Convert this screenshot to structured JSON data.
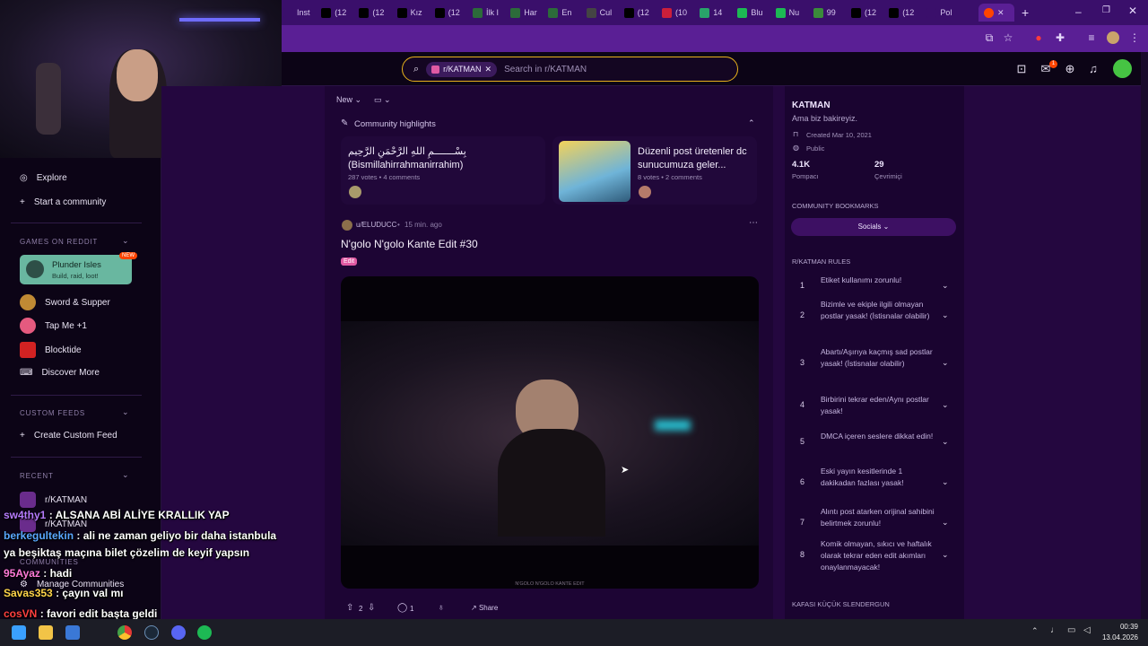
{
  "browser": {
    "tabs": [
      "Inst",
      "(12",
      "(12",
      "Kız",
      "(12",
      "İlk I",
      "Har",
      "En",
      "Cul",
      "(12",
      "(10",
      "14",
      "Blu",
      "Nu",
      "99",
      "(12",
      "(12",
      "Pol"
    ],
    "tab_colors": [
      "#3a0f6b",
      "#000000",
      "#000000",
      "#000000",
      "#000000",
      "#2c6b3a",
      "#2c6b3a",
      "#2c6b3a",
      "#444444",
      "#000000",
      "#cc1f3a",
      "#29a36a",
      "#1db954",
      "#1db954",
      "#3b8b3b",
      "#000000",
      "#000000",
      "#3a0f6b"
    ]
  },
  "search": {
    "chip_label": "r/KATMAN",
    "placeholder": "Search in r/KATMAN"
  },
  "header": {
    "notification_count": "1"
  },
  "sidebar": {
    "explore": "Explore",
    "start_community": "Start a community",
    "games_heading": "GAMES ON REDDIT",
    "featured_game": {
      "title": "Plunder Isles",
      "subtitle": "Build, raid, loot!",
      "badge": "NEW"
    },
    "games": [
      "Sword & Supper",
      "Tap Me +1",
      "Blocktide",
      "Discover More"
    ],
    "custom_feeds_heading": "CUSTOM FEEDS",
    "create_feed": "Create Custom Feed",
    "recent_heading": "RECENT",
    "recent_items": [
      "r/KATMAN",
      "r/KATMAN"
    ],
    "communities_heading": "COMMUNITIES",
    "manage_communities": "Manage Communities"
  },
  "feed": {
    "sort_label": "New",
    "highlights_title": "Community highlights",
    "highlights": [
      {
        "title": "بِسْـــــــمِ اللهِ الرَّحْمَنِ الرَّحِيم (Bismillahirrahmanirrahim)",
        "meta": "287 votes • 4 comments"
      },
      {
        "title": "Düzenli post üretenler dc sunucumuza geler...",
        "meta": "8 votes • 2 comments"
      }
    ],
    "post": {
      "author": "u/ELUDUCC",
      "time": "15 min. ago",
      "title": "N'golo N'golo Kante Edit #30",
      "flair": "Edit",
      "video_caption": "N'GOLO N'GOLO KANTE EDIT",
      "votes": "2",
      "comments": "1",
      "share_label": "Share"
    }
  },
  "community": {
    "name": "KATMAN",
    "description": "Ama biz bakireyiz.",
    "created": "Created Mar 10, 2021",
    "visibility": "Public",
    "members": "4.1K",
    "members_label": "Pompacı",
    "online": "29",
    "online_label": "Çevrimiçi",
    "bookmarks_heading": "COMMUNITY BOOKMARKS",
    "socials_button": "Socials",
    "rules_heading": "R/KATMAN RULES",
    "rules": [
      {
        "num": "1",
        "text": "Etiket kullanımı zorunlu!"
      },
      {
        "num": "2",
        "text": "Bizimle ve ekiple ilgili olmayan postlar yasak! (İstisnalar olabilir)"
      },
      {
        "num": "3",
        "text": "Abartı/Aşırıya kaçmış sad postlar yasak! (İstisnalar olabilir)"
      },
      {
        "num": "4",
        "text": "Birbirini tekrar eden/Aynı postlar yasak!"
      },
      {
        "num": "5",
        "text": "DMCA içeren seslere dikkat edin!"
      },
      {
        "num": "6",
        "text": "Eski yayın kesitlerinde 1 dakikadan fazlası yasak!"
      },
      {
        "num": "7",
        "text": "Alıntı post atarken orijinal sahibini belirtmek zorunlu!"
      },
      {
        "num": "8",
        "text": "Komik olmayan, sıkıcı ve haftalık olarak tekrar eden edit akımları onaylanmayacak!"
      }
    ],
    "next_heading": "KAFASI KÜÇÜK SLENDERGUN"
  },
  "chat": [
    {
      "user": "sw4thy1",
      "color": "#b77bff",
      "msg": "ALSANA ABİ ALİYE KRALLIK YAP"
    },
    {
      "user": "berkegultekin",
      "color": "#5aa7ff",
      "msg": "ali ne zaman geliyo bir daha istanbula"
    },
    {
      "user": "",
      "color": "#ffffff",
      "msg": "ya beşiktaş maçına bilet çözelim de keyif yapsın"
    },
    {
      "user": "95Ayaz",
      "color": "#ff7ad9",
      "msg": "hadi"
    },
    {
      "user": "Savas353",
      "color": "#ffd54a",
      "msg": "çayın val mı"
    },
    {
      "user": "cosVN",
      "color": "#ff4040",
      "msg": "favori edit başta geldi"
    }
  ],
  "taskbar": {
    "time": "00:39",
    "date": "13.04.2026"
  }
}
